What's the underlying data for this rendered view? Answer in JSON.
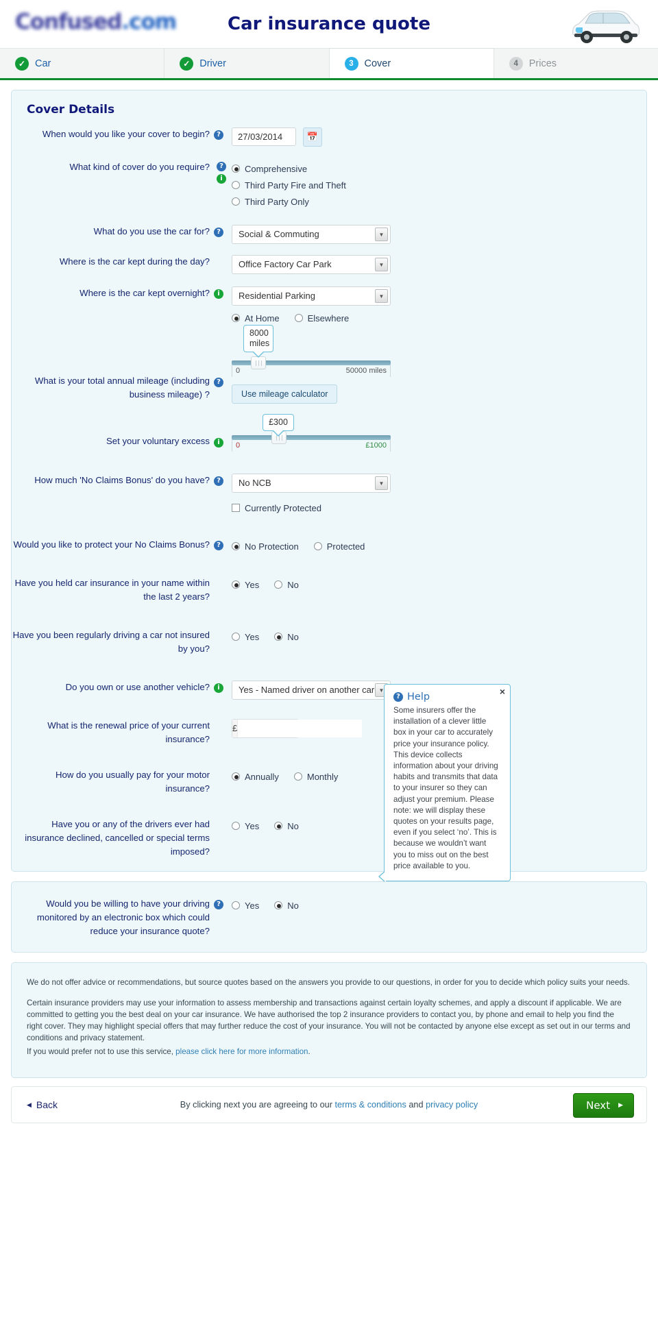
{
  "header": {
    "logo_text": "Confused",
    "logo_suffix": ".com",
    "title": "Car insurance quote",
    "car_icon": "car-photo"
  },
  "tabs": [
    {
      "label": "Car",
      "badge": "✓",
      "state": "done"
    },
    {
      "label": "Driver",
      "badge": "✓",
      "state": "done"
    },
    {
      "label": "Cover",
      "badge": "3",
      "state": "current"
    },
    {
      "label": "Prices",
      "badge": "4",
      "state": "todo"
    }
  ],
  "cover": {
    "panel_title": "Cover Details",
    "help_glyph": "?",
    "info_glyph": "i",
    "fields": {
      "cover_begin": {
        "label": "When would you like your cover to begin?",
        "value": "27/03/2014",
        "calendar_icon": "calendar-icon"
      },
      "cover_kind": {
        "label": "What kind of cover do you require?",
        "options": [
          "Comprehensive",
          "Third Party Fire and Theft",
          "Third Party Only"
        ],
        "selected": "Comprehensive"
      },
      "car_use": {
        "label": "What do you use the car for?",
        "value": "Social & Commuting"
      },
      "kept_day": {
        "label": "Where is the car kept during the day?",
        "value": "Office Factory Car Park"
      },
      "kept_night": {
        "label": "Where is the car kept overnight?",
        "value": "Residential Parking",
        "options": [
          "At Home",
          "Elsewhere"
        ],
        "selected": "At Home"
      },
      "mileage": {
        "label": "What is your total annual mileage (including business mileage) ?",
        "bubble_value": "8000",
        "bubble_unit": "miles",
        "min_label": "0",
        "max_label": "50000 miles",
        "percent": 16,
        "calculator_button": "Use mileage calculator"
      },
      "excess": {
        "label": "Set your voluntary excess",
        "bubble_value": "£300",
        "min_label": "0",
        "max_label": "£1000",
        "min_color": "#b03030",
        "max_color": "#2e8b3f",
        "percent": 30
      },
      "ncb": {
        "label": "How much 'No Claims Bonus' do you have?",
        "value": "No NCB",
        "checkbox_label": "Currently Protected",
        "checkbox_checked": false
      },
      "ncb_protect": {
        "label": "Would you like to protect your No Claims Bonus?",
        "options": [
          "No Protection",
          "Protected"
        ],
        "selected": "No Protection"
      },
      "held_insurance": {
        "label": "Have you held car insurance in your name within the last 2 years?",
        "options": [
          "Yes",
          "No"
        ],
        "selected": "Yes"
      },
      "driving_other": {
        "label": "Have you been regularly driving a car not insured by you?",
        "options": [
          "Yes",
          "No"
        ],
        "selected": "No"
      },
      "another_vehicle": {
        "label": "Do you own or use another vehicle?",
        "value": "Yes - Named driver on another car"
      },
      "renewal_price": {
        "label": "What is the renewal price of your current insurance?",
        "symbol": "£",
        "value": "",
        "placeholder": ""
      },
      "pay_method": {
        "label": "How do you usually pay for your motor insurance?",
        "options": [
          "Annually",
          "Monthly"
        ],
        "selected": "Annually"
      },
      "declined": {
        "label": "Have you or any of the drivers ever had insurance declined, cancelled or special terms imposed?",
        "options": [
          "Yes",
          "No"
        ],
        "selected": "No"
      }
    }
  },
  "telematics": {
    "label": "Would you be willing to have your driving monitored by an electronic box which could reduce your insurance quote?",
    "options": [
      "Yes",
      "No"
    ],
    "selected": "No"
  },
  "help_popup": {
    "title": "Help",
    "icon": "question-mark-icon",
    "close": "×",
    "body": "Some insurers offer the installation of a clever little box in your car to accurately price your insurance policy. This device collects information about your driving habits and transmits that data to your insurer so they can adjust your premium. Please note: we will display these quotes on your results page, even if you select ‘no’. This is because we wouldn’t want you to miss out on the best price available to you."
  },
  "disclaimer": {
    "p1": "We do not offer advice or recommendations, but source quotes based on the answers you provide to our questions, in order for you to decide which policy suits your needs.",
    "p2": "Certain insurance providers may use your information to assess membership and transactions against certain loyalty schemes, and apply a discount if applicable. We are committed to getting you the best deal on your car insurance. We have authorised the top 2 insurance providers to contact you, by phone and email to help you find the right cover.  They may highlight special offers that may further reduce the cost of your insurance. You will not be contacted by anyone else except as set out in our terms and conditions and privacy statement.",
    "p3_prefix": "If you would prefer not to use this service, ",
    "p3_link": "please click here for more information",
    "p3_suffix": "."
  },
  "footer": {
    "back_label": "Back",
    "back_arrow": "◀",
    "agree_prefix": "By clicking next you are agreeing to our ",
    "terms_link": "terms & conditions",
    "agree_mid": " and ",
    "privacy_link": "privacy policy",
    "next_label": "Next",
    "next_arrow": "▶"
  },
  "colors": {
    "brand_blue": "#10197a",
    "tab_green": "#0f8b2f",
    "accent_cyan": "#2ab0e8",
    "panel_bg": "#eef8fb",
    "next_green": "#2f9c19",
    "link": "#2f7fb5"
  }
}
